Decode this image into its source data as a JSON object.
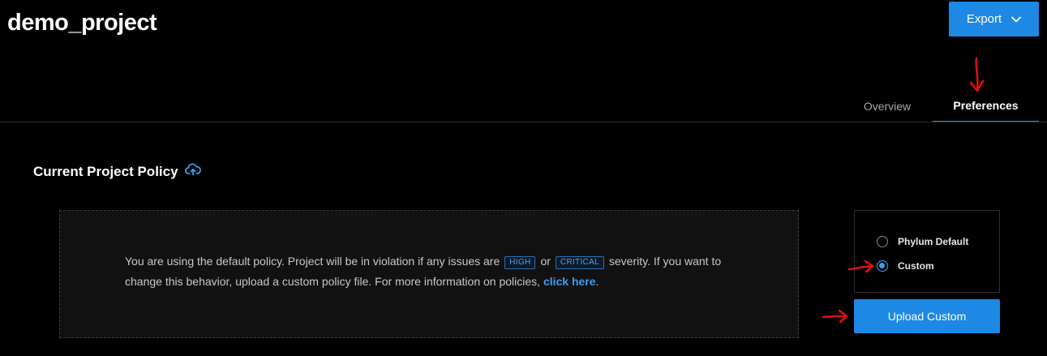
{
  "header": {
    "project_title": "demo_project",
    "export_label": "Export"
  },
  "tabs": [
    {
      "label": "Overview",
      "active": false
    },
    {
      "label": "Preferences",
      "active": true
    }
  ],
  "policy_section": {
    "title": "Current Project Policy",
    "message_part1": "You are using the default policy. Project will be in violation if any issues are",
    "tag_high": "HIGH",
    "message_or": "or",
    "tag_critical": "CRITICAL",
    "message_part2": "severity. If you want to change this behavior, upload a custom policy file. For more information on policies,",
    "link_label": "click here",
    "message_end": "."
  },
  "policy_options": {
    "options": [
      {
        "label": "Phylum Default",
        "selected": false
      },
      {
        "label": "Custom",
        "selected": true
      }
    ],
    "upload_label": "Upload Custom"
  },
  "colors": {
    "accent": "#1e88e5",
    "link": "#3d9cf0",
    "background": "#000000",
    "panel": "#111111",
    "annotation_arrow": "#e01010"
  },
  "icons": {
    "export_dropdown": "chevron-down-icon",
    "policy_upload": "cloud-upload-icon"
  }
}
